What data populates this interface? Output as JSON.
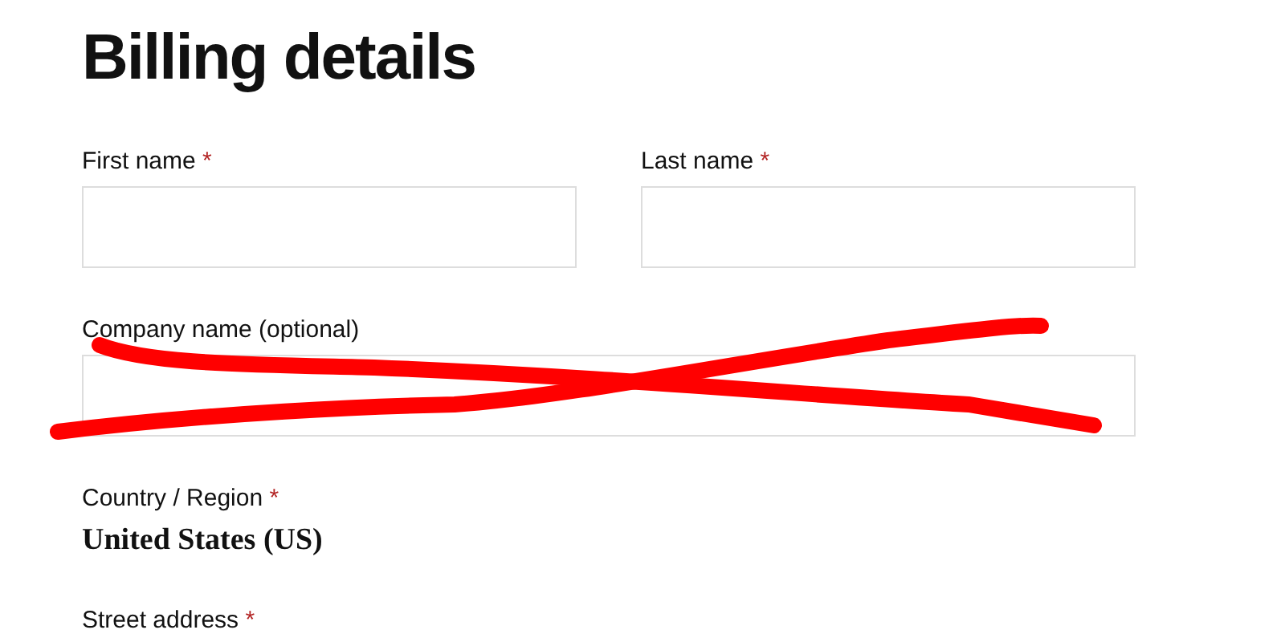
{
  "title": "Billing details",
  "fields": [
    {
      "label": "First name",
      "required_mark": "*",
      "kind": "input"
    },
    {
      "label": "Last name",
      "required_mark": "*",
      "kind": "input"
    }
  ],
  "company": {
    "label": "Company name (optional)",
    "kind": "input",
    "crossed_out": true
  },
  "country": {
    "label": "Country / Region",
    "required_mark": "*",
    "value": "United States (US)"
  },
  "street": {
    "label": "Street address",
    "required_mark": "*"
  }
}
